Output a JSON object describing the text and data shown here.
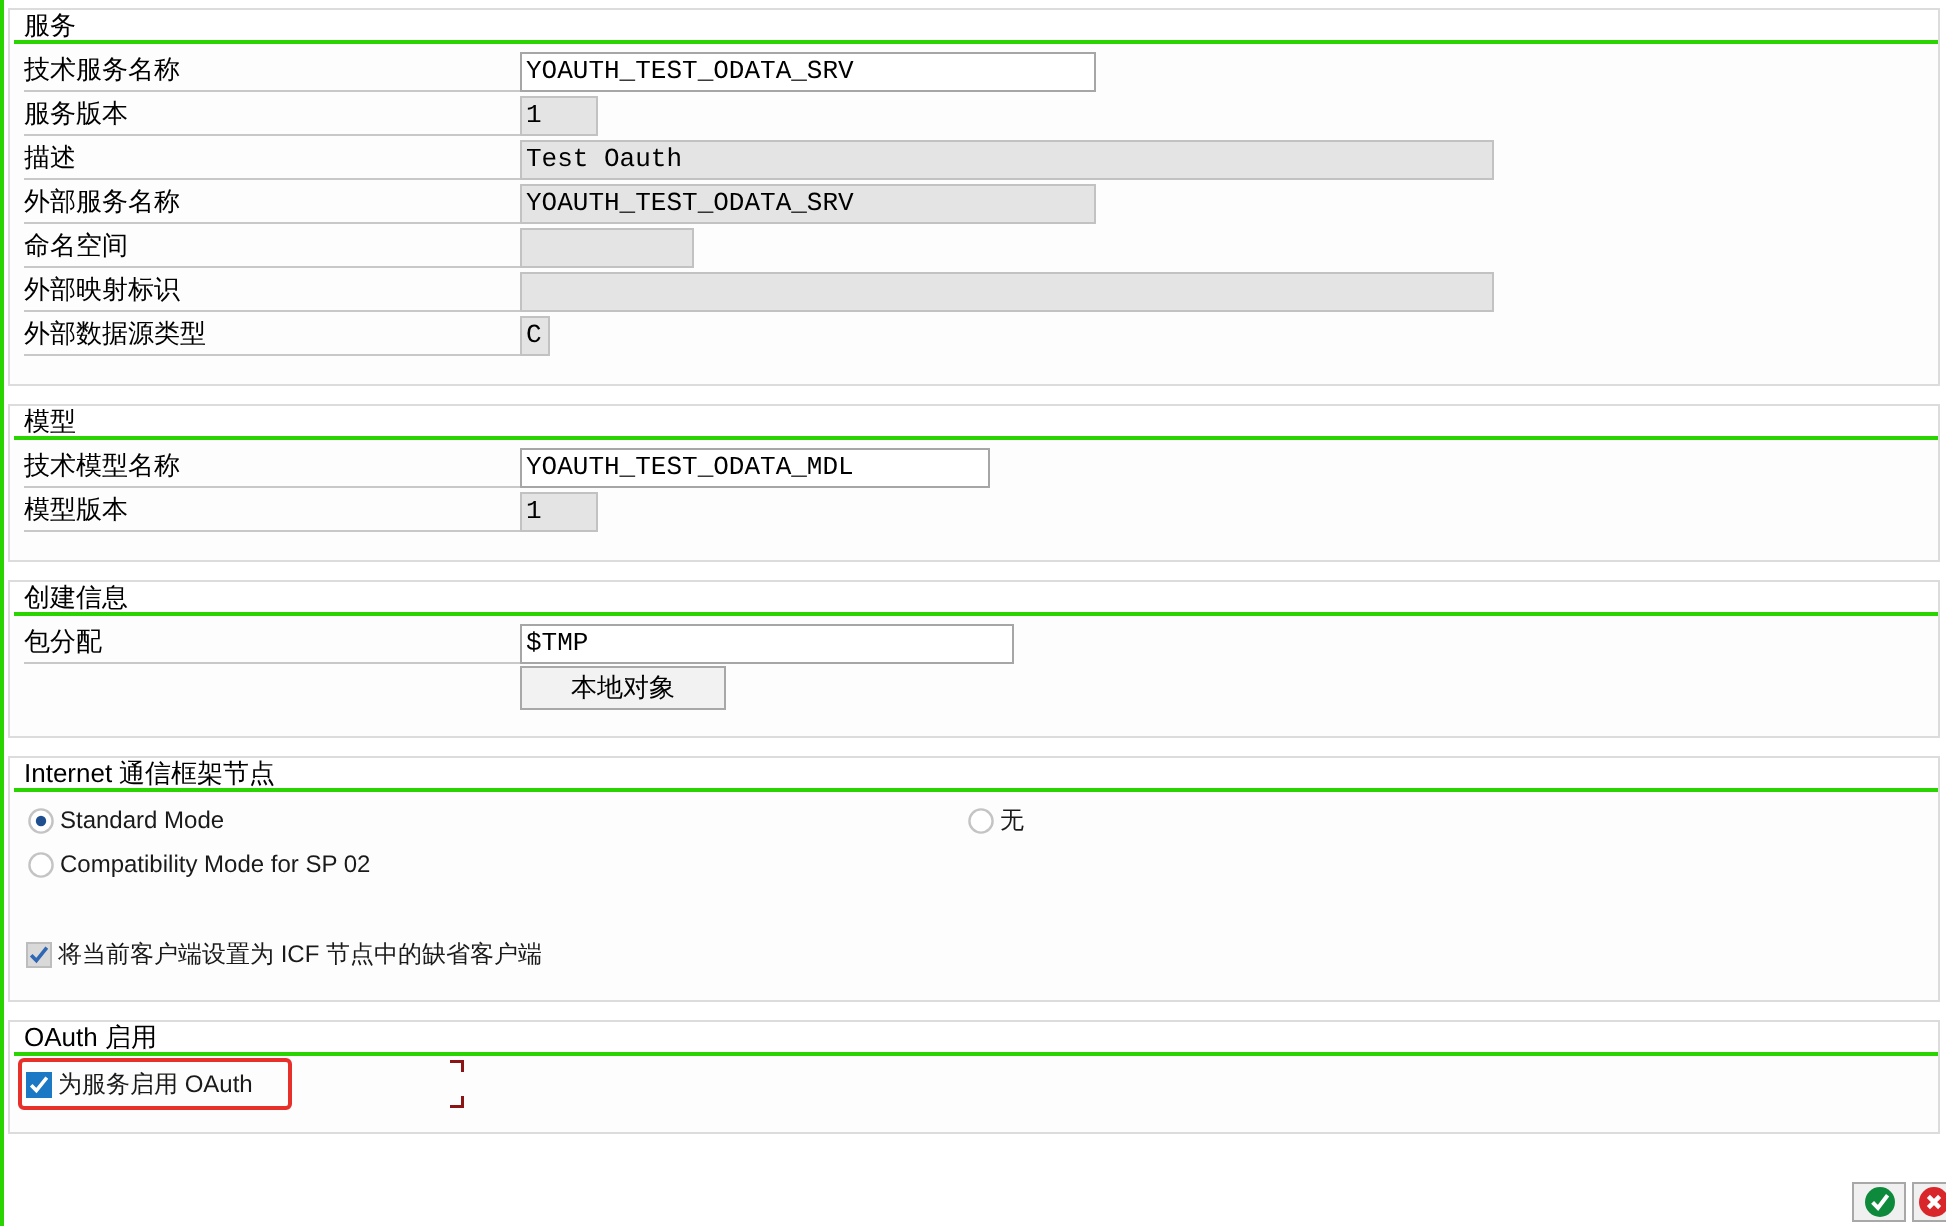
{
  "sections": [
    {
      "title": "服务",
      "fields": [
        {
          "label": "技术服务名称",
          "value": "YOAUTH_TEST_ODATA_SRV",
          "disabled": false
        },
        {
          "label": "服务版本",
          "value": "1",
          "disabled": true
        },
        {
          "label": "描述",
          "value": "Test Oauth",
          "disabled": true
        },
        {
          "label": "外部服务名称",
          "value": "YOAUTH_TEST_ODATA_SRV",
          "disabled": true
        },
        {
          "label": "命名空间",
          "disabled": true
        },
        {
          "label": "外部映射标识",
          "disabled": true
        },
        {
          "label": "外部数据源类型",
          "value": "C",
          "disabled": true
        }
      ]
    },
    {
      "title": "模型",
      "fields": [
        {
          "label": "技术模型名称",
          "value": "YOAUTH_TEST_ODATA_MDL",
          "disabled": false
        },
        {
          "label": "模型版本",
          "value": "1",
          "disabled": true
        }
      ]
    },
    {
      "title": "创建信息",
      "fields": [
        {
          "label": "包分配",
          "value": "$TMP",
          "disabled": false
        }
      ],
      "button": "本地对象"
    },
    {
      "title": "Internet 通信框架节点",
      "radios": [
        {
          "label": "Standard Mode",
          "selected": true
        },
        {
          "label": "无",
          "selected": false
        },
        {
          "label": "Compatibility Mode for SP 02",
          "selected": false
        }
      ],
      "checkboxes": [
        {
          "label": "将当前客户端设置为 ICF 节点中的缺省客户端",
          "checked": true,
          "disabled": true,
          "highlighted": false,
          "focused": false
        }
      ]
    },
    {
      "title": "OAuth 启用",
      "checkboxes": [
        {
          "label": "为服务启用 OAuth",
          "checked": true,
          "disabled": false,
          "highlighted": true,
          "focused": true
        }
      ]
    }
  ],
  "footer_buttons": [
    {
      "kind": "confirm"
    },
    {
      "kind": "cancel"
    }
  ]
}
